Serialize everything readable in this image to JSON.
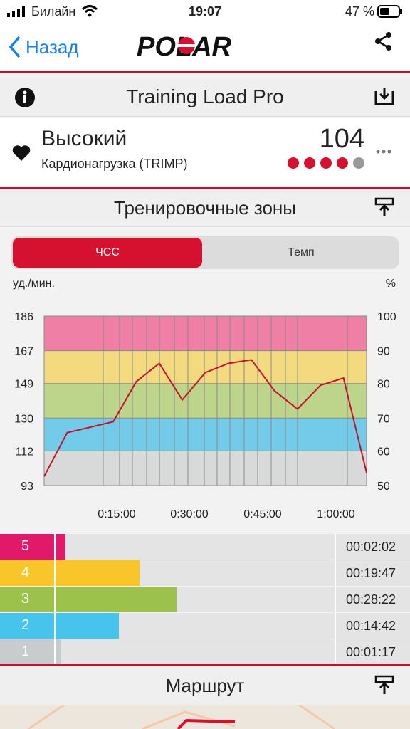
{
  "status_bar": {
    "carrier": "Билайн",
    "time": "19:07",
    "battery": "47 %"
  },
  "nav": {
    "back_label": "Назад",
    "logo_text": "POLAR",
    "share_icon": "share-icon"
  },
  "training_load": {
    "title": "Training Load Pro",
    "level": "Высокий",
    "metric": "Кардионагрузка (TRIMP)",
    "value": "104",
    "dots_filled": 4,
    "dots_total": 5,
    "accent": "#d6102f"
  },
  "zones": {
    "title": "Тренировочные зоны",
    "tabs": [
      {
        "label": "ЧСС",
        "active": true
      },
      {
        "label": "Темп",
        "active": false
      }
    ],
    "left_unit": "уд./мин.",
    "right_unit": "%"
  },
  "chart_data": {
    "type": "line",
    "x": [
      "0:00",
      "0:05",
      "0:10",
      "0:15",
      "0:20",
      "0:25",
      "0:30",
      "0:35",
      "0:40",
      "0:45",
      "0:50",
      "0:55",
      "1:00",
      "1:05",
      "1:07"
    ],
    "x_tick_labels": [
      "0:15:00",
      "0:30:00",
      "0:45:00",
      "1:00:00"
    ],
    "y_left_ticks": [
      "186",
      "167",
      "149",
      "130",
      "112",
      "93"
    ],
    "y_right_ticks": [
      "100",
      "90",
      "80",
      "70",
      "60",
      "50"
    ],
    "ylim": [
      93,
      186
    ],
    "series": [
      {
        "values": [
          98,
          122,
          125,
          128,
          150,
          160,
          140,
          155,
          160,
          162,
          145,
          135,
          148,
          152,
          100
        ],
        "color": "#c8102e"
      }
    ],
    "zone_colors": [
      "#d3d6d6",
      "#5cc6e8",
      "#b4cf79",
      "#f5d66a",
      "#f06b99"
    ],
    "grid": true
  },
  "zone_bars": [
    {
      "zone": "5",
      "duration": "00:02:02",
      "fraction": 0.16,
      "color": "#e0196b"
    },
    {
      "zone": "4",
      "duration": "00:19:47",
      "fraction": 0.34,
      "color": "#f8c62b"
    },
    {
      "zone": "3",
      "duration": "00:28:22",
      "fraction": 0.43,
      "color": "#9dc24b"
    },
    {
      "zone": "2",
      "duration": "00:14:42",
      "fraction": 0.29,
      "color": "#47c4ec"
    },
    {
      "zone": "1",
      "duration": "00:01:17",
      "fraction": 0.15,
      "color": "#c8cccc"
    }
  ],
  "route": {
    "title": "Маршрут"
  }
}
